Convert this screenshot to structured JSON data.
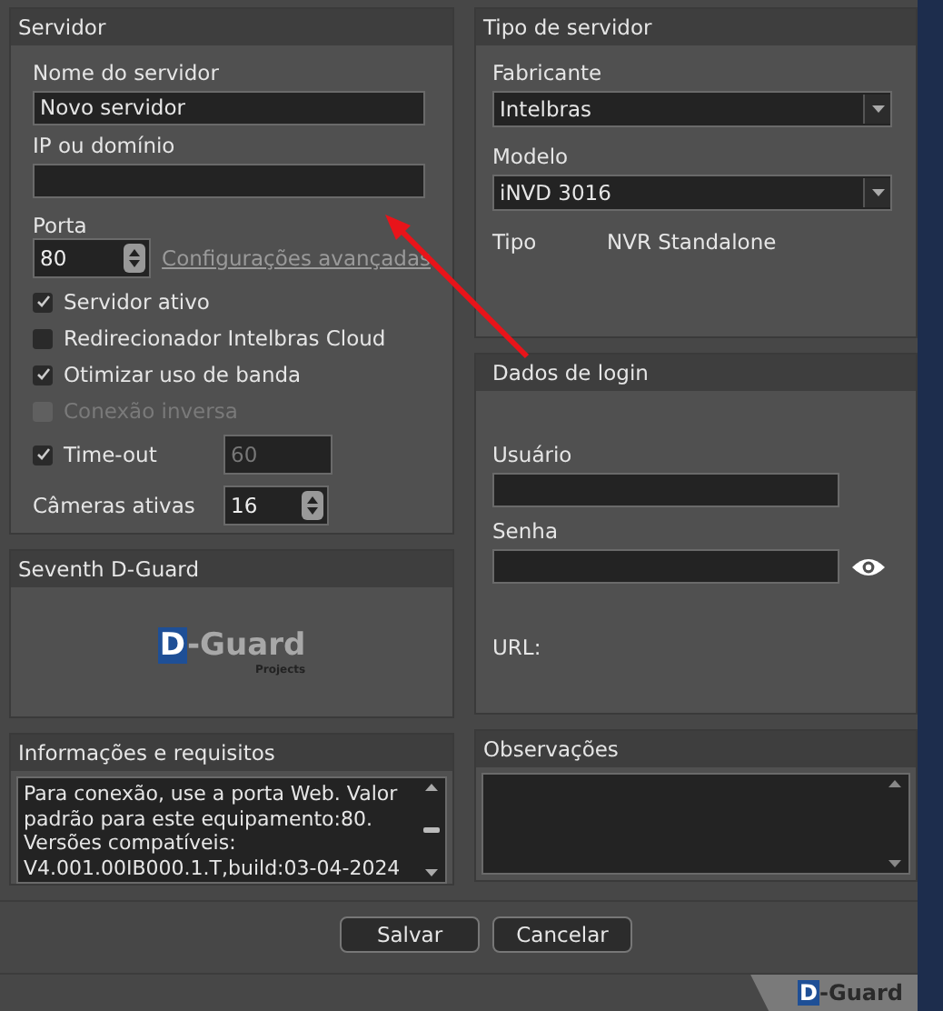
{
  "servidor": {
    "title": "Servidor",
    "name_label": "Nome do servidor",
    "name_value": "Novo servidor",
    "ip_label": "IP ou domínio",
    "port_label": "Porta",
    "port_value": "80",
    "advanced_link": "Configurações avançadas",
    "options": [
      {
        "label": "Servidor ativo",
        "checked": true,
        "disabled": false
      },
      {
        "label": "Redirecionador Intelbras Cloud",
        "checked": false,
        "disabled": false
      },
      {
        "label": "Otimizar uso de banda",
        "checked": true,
        "disabled": false
      },
      {
        "label": "Conexão inversa",
        "checked": false,
        "disabled": true
      }
    ],
    "timeout": {
      "label": "Time-out",
      "checked": true,
      "value": "60"
    },
    "cameras_label": "Câmeras ativas",
    "cameras_value": "16"
  },
  "tipo": {
    "title": "Tipo de servidor",
    "manufacturer_label": "Fabricante",
    "manufacturer_value": "Intelbras",
    "model_label": "Modelo",
    "model_value": "iNVD 3016",
    "type_label": "Tipo",
    "type_value": "NVR Standalone"
  },
  "login": {
    "title": "Dados de login",
    "user_label": "Usuário",
    "password_label": "Senha",
    "url_label": "URL:"
  },
  "seventh": {
    "title": "Seventh D-Guard",
    "logo": {
      "mark": "D",
      "text": "-Guard",
      "sub": "Projects"
    }
  },
  "info": {
    "title": "Informações e requisitos",
    "text": "Para conexão, use a porta Web. Valor padrão para este equipamento:80. Versões compatíveis: V4.001.00IB000.1.T,build:03-04-2024"
  },
  "observacoes": {
    "title": "Observações"
  },
  "buttons": [
    "Salvar",
    "Cancelar"
  ],
  "footer_logo": {
    "mark": "D",
    "text": "-Guard"
  }
}
